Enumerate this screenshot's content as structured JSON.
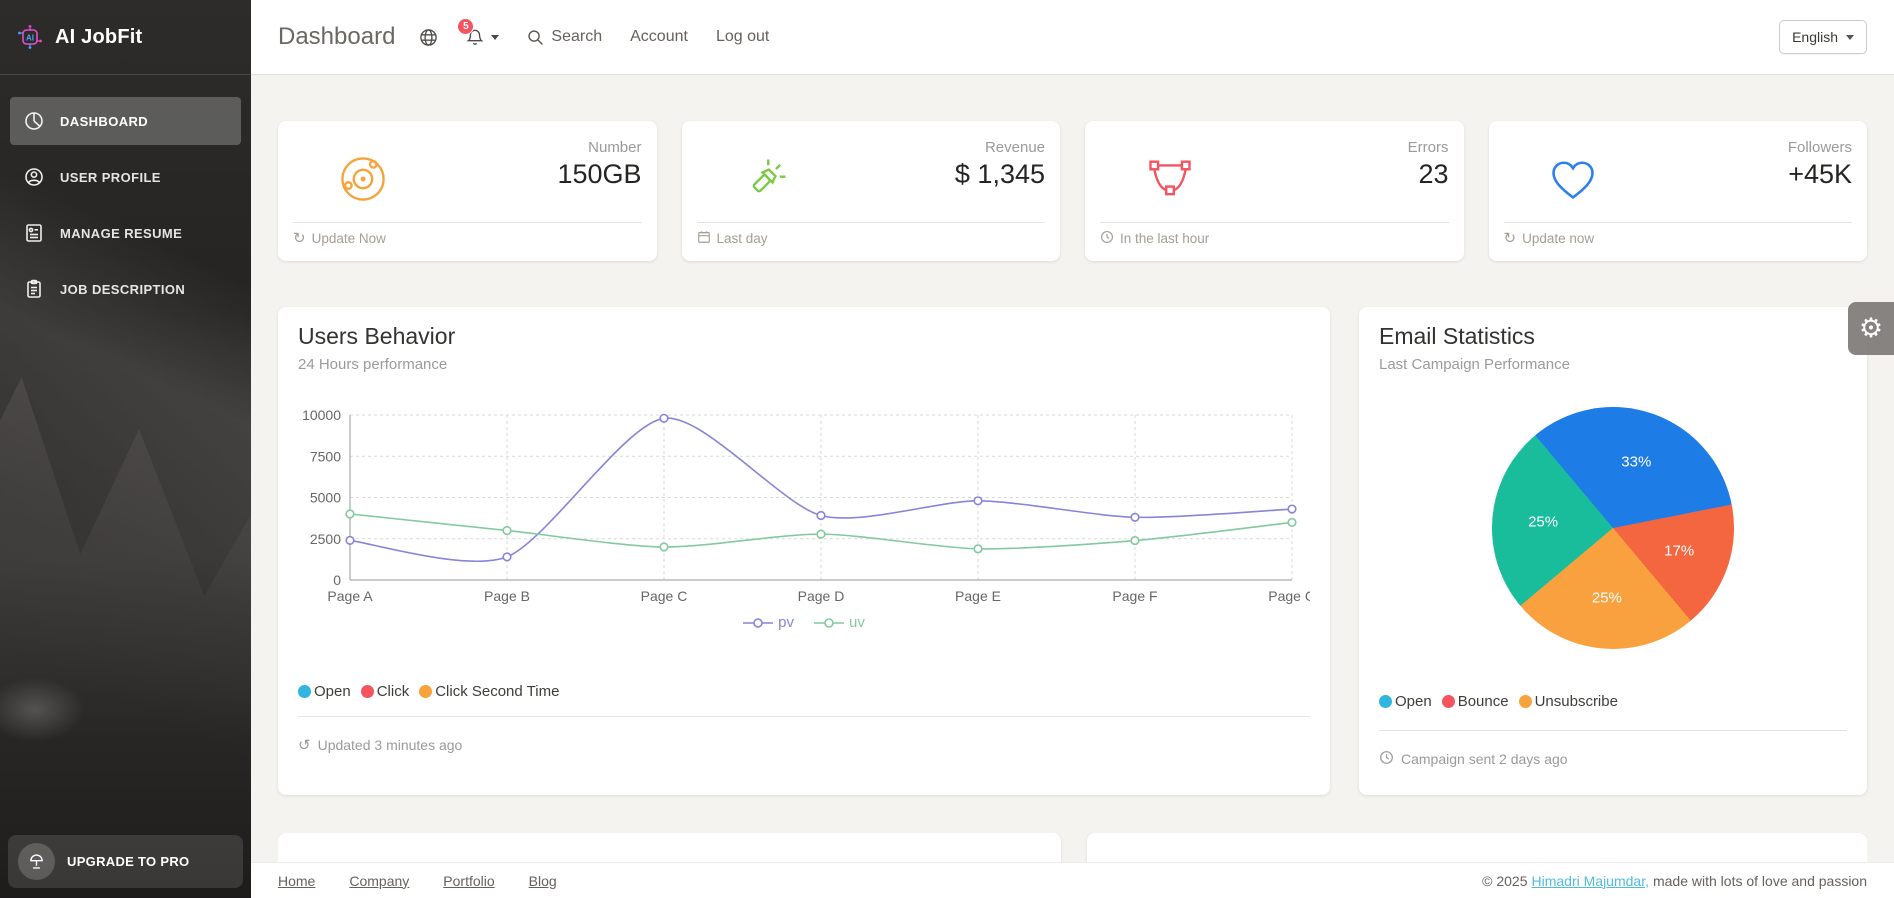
{
  "navbar": {
    "title": "Dashboard",
    "notification_badge": "5",
    "search_label": "Search",
    "account_label": "Account",
    "logout_label": "Log out",
    "language_selector": "English"
  },
  "sidebar": {
    "brand": "AI JobFit",
    "items": [
      {
        "label": "DASHBOARD"
      },
      {
        "label": "USER PROFILE"
      },
      {
        "label": "MANAGE RESUME"
      },
      {
        "label": "JOB DESCRIPTION"
      }
    ],
    "upgrade_label": "UPGRADE TO PRO"
  },
  "stat_cards": [
    {
      "category": "Number",
      "value": "150GB",
      "footer": "Update Now",
      "icon_color": "#f7a33c"
    },
    {
      "category": "Revenue",
      "value": "$ 1,345",
      "footer": "Last day",
      "icon_color": "#7ac943"
    },
    {
      "category": "Errors",
      "value": "23",
      "footer": "In the last hour",
      "icon_color": "#f3545f"
    },
    {
      "category": "Followers",
      "value": "+45K",
      "footer": "Update now",
      "icon_color": "#2d7ff0"
    }
  ],
  "users_behavior": {
    "title": "Users Behavior",
    "subtitle": "24 Hours performance",
    "legend": [
      {
        "label": "Open",
        "color": "#2fb5df"
      },
      {
        "label": "Click",
        "color": "#f3545f"
      },
      {
        "label": "Click Second Time",
        "color": "#f7a33c"
      }
    ],
    "footer": "Updated 3 minutes ago"
  },
  "email_statistics": {
    "title": "Email Statistics",
    "subtitle": "Last Campaign Performance",
    "legend": [
      {
        "label": "Open",
        "color": "#2fb5df"
      },
      {
        "label": "Bounce",
        "color": "#f3545f"
      },
      {
        "label": "Unsubscribe",
        "color": "#f7a33c"
      }
    ],
    "footer": "Campaign sent 2 days ago"
  },
  "chart_data": [
    {
      "type": "line",
      "title": "Users Behavior",
      "x": [
        "Page A",
        "Page B",
        "Page C",
        "Page D",
        "Page E",
        "Page F",
        "Page G"
      ],
      "series": [
        {
          "name": "pv",
          "color": "#8884d8",
          "values": [
            2400,
            1398,
            9800,
            3908,
            4800,
            3800,
            4300
          ]
        },
        {
          "name": "uv",
          "color": "#82ca9d",
          "values": [
            4000,
            3000,
            2000,
            2780,
            1890,
            2390,
            3490
          ]
        }
      ],
      "ylim": [
        0,
        10000
      ],
      "yticks": [
        0,
        2500,
        5000,
        7500,
        10000
      ],
      "grid": true,
      "legend_position": "bottom"
    },
    {
      "type": "pie",
      "title": "Email Statistics",
      "start_angle": -40,
      "slices": [
        {
          "label": "Open",
          "value": 33,
          "display": "33%",
          "color": "#1e7ce6"
        },
        {
          "label": "Bounce",
          "value": 17,
          "display": "17%",
          "color": "#f4663f"
        },
        {
          "label": "Unsubscribe",
          "value": 25,
          "display": "25%",
          "color": "#f9a13e"
        },
        {
          "label": "",
          "value": 25,
          "display": "25%",
          "color": "#19bc9b"
        }
      ]
    }
  ],
  "footer": {
    "links": [
      {
        "label": "Home"
      },
      {
        "label": "Company"
      },
      {
        "label": "Portfolio"
      },
      {
        "label": "Blog"
      }
    ],
    "copyright_prefix": "© 2025",
    "copyright_link": "Himadri Majumdar,",
    "copyright_suffix": "made with lots of love and passion"
  }
}
